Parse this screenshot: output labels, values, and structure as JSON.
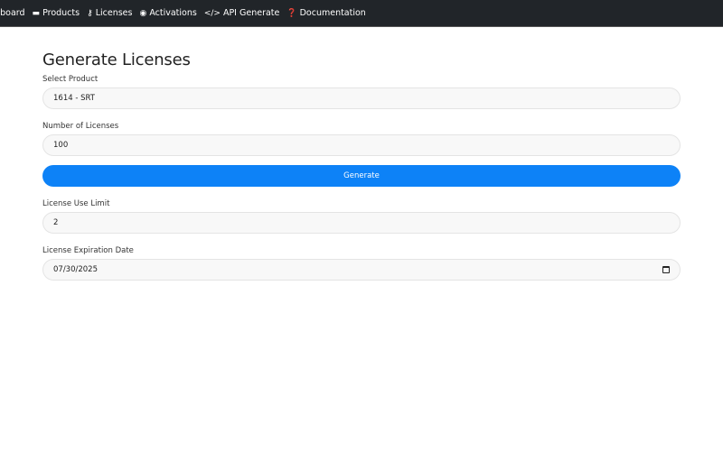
{
  "nav": {
    "items": [
      {
        "label": "Dashboard",
        "icon": "dashboard-icon",
        "glyph": ""
      },
      {
        "label": "Products",
        "icon": "box-icon",
        "glyph": "▬"
      },
      {
        "label": "Licenses",
        "icon": "key-icon",
        "glyph": "⚷"
      },
      {
        "label": "Activations",
        "icon": "toggle-icon",
        "glyph": "◉"
      },
      {
        "label": "API Generate",
        "icon": "code-icon",
        "glyph": "</>"
      },
      {
        "label": "Documentation",
        "icon": "question-circle-icon",
        "glyph": "❓"
      }
    ]
  },
  "form": {
    "title": "Generate Licenses",
    "product_label": "Select Product",
    "product_value": "1614 - SRT",
    "count_label": "Number of Licenses",
    "count_value": "100",
    "generate_label": "Generate",
    "limit_label": "License Use Limit",
    "limit_value": "2",
    "expiry_label": "License Expiration Date",
    "expiry_value": "07/30/2025"
  },
  "colors": {
    "navbar": "#212529",
    "primary": "#0d82f7"
  }
}
